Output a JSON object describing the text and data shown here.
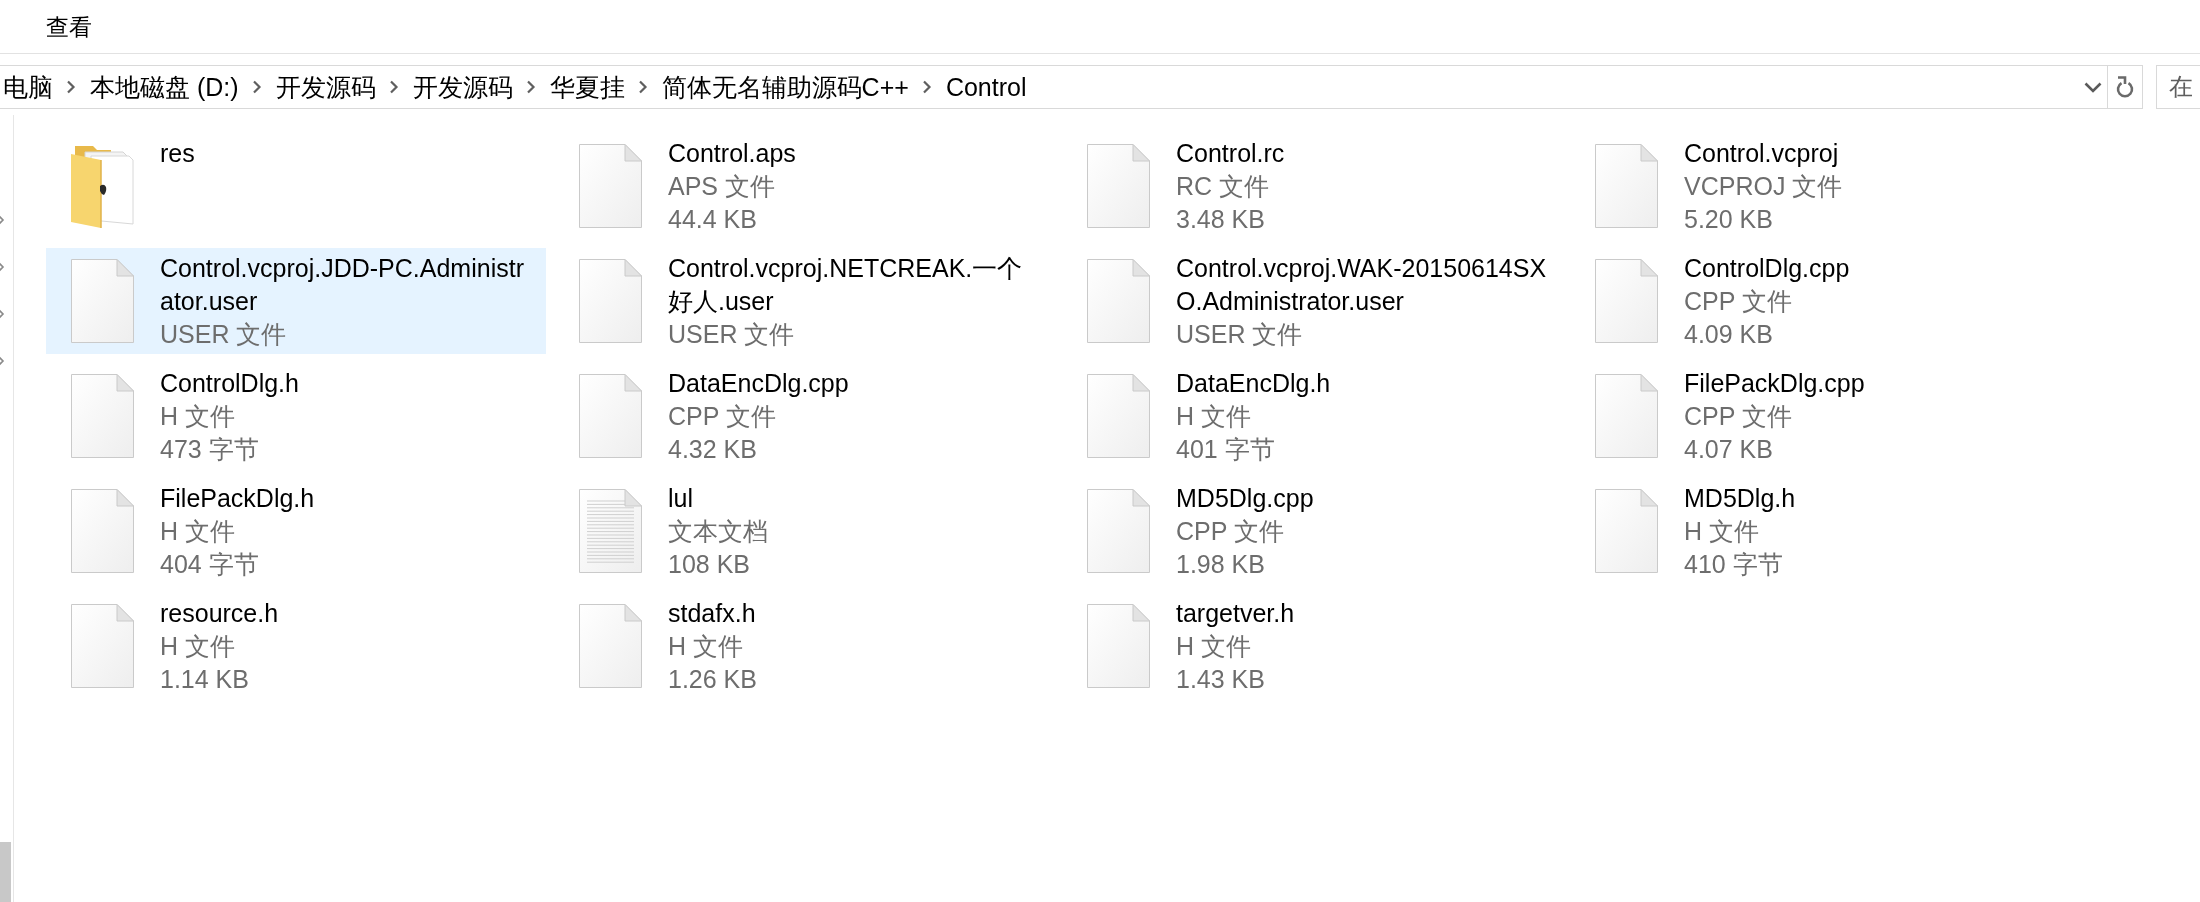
{
  "ribbon": {
    "tabs": [
      {
        "label": "查看"
      }
    ]
  },
  "address_bar": {
    "breadcrumbs": [
      "电脑",
      "本地磁盘 (D:)",
      "开发源码",
      "开发源码",
      "华夏挂",
      "简体无名辅助源码C++",
      "Control"
    ]
  },
  "search": {
    "placeholder": "在"
  },
  "navigation_pane": {
    "items": [
      {
        "expanded": false
      },
      {
        "expanded": false
      },
      {
        "expanded": false
      },
      {
        "expanded": false
      }
    ]
  },
  "files": [
    {
      "name": "res",
      "kind": "folder",
      "selected": false
    },
    {
      "name": "Control.aps",
      "type": "APS 文件",
      "size": "44.4 KB",
      "kind": "file",
      "selected": false
    },
    {
      "name": "Control.rc",
      "type": "RC 文件",
      "size": "3.48 KB",
      "kind": "file",
      "selected": false
    },
    {
      "name": "Control.vcproj",
      "type": "VCPROJ 文件",
      "size": "5.20 KB",
      "kind": "file",
      "selected": false
    },
    {
      "name": "Control.vcproj.JDD-PC.Administrator.user",
      "type": "USER 文件",
      "kind": "file",
      "selected": true
    },
    {
      "name": "Control.vcproj.NETCREAK.一个好人.user",
      "type": "USER 文件",
      "kind": "file",
      "selected": false
    },
    {
      "name": "Control.vcproj.WAK-20150614SXO.Administrator.user",
      "type": "USER 文件",
      "kind": "file",
      "selected": false
    },
    {
      "name": "ControlDlg.cpp",
      "type": "CPP 文件",
      "size": "4.09 KB",
      "kind": "file",
      "selected": false
    },
    {
      "name": "ControlDlg.h",
      "type": "H 文件",
      "size": "473 字节",
      "kind": "file",
      "selected": false
    },
    {
      "name": "DataEncDlg.cpp",
      "type": "CPP 文件",
      "size": "4.32 KB",
      "kind": "file",
      "selected": false
    },
    {
      "name": "DataEncDlg.h",
      "type": "H 文件",
      "size": "401 字节",
      "kind": "file",
      "selected": false
    },
    {
      "name": "FilePackDlg.cpp",
      "type": "CPP 文件",
      "size": "4.07 KB",
      "kind": "file",
      "selected": false
    },
    {
      "name": "FilePackDlg.h",
      "type": "H 文件",
      "size": "404 字节",
      "kind": "file",
      "selected": false
    },
    {
      "name": "lul",
      "type": "文本文档",
      "size": "108 KB",
      "kind": "text",
      "selected": false
    },
    {
      "name": "MD5Dlg.cpp",
      "type": "CPP 文件",
      "size": "1.98 KB",
      "kind": "file",
      "selected": false
    },
    {
      "name": "MD5Dlg.h",
      "type": "H 文件",
      "size": "410 字节",
      "kind": "file",
      "selected": false
    },
    {
      "name": "resource.h",
      "type": "H 文件",
      "size": "1.14 KB",
      "kind": "file",
      "selected": false
    },
    {
      "name": "stdafx.h",
      "type": "H 文件",
      "size": "1.26 KB",
      "kind": "file",
      "selected": false
    },
    {
      "name": "targetver.h",
      "type": "H 文件",
      "size": "1.43 KB",
      "kind": "file",
      "selected": false
    }
  ]
}
